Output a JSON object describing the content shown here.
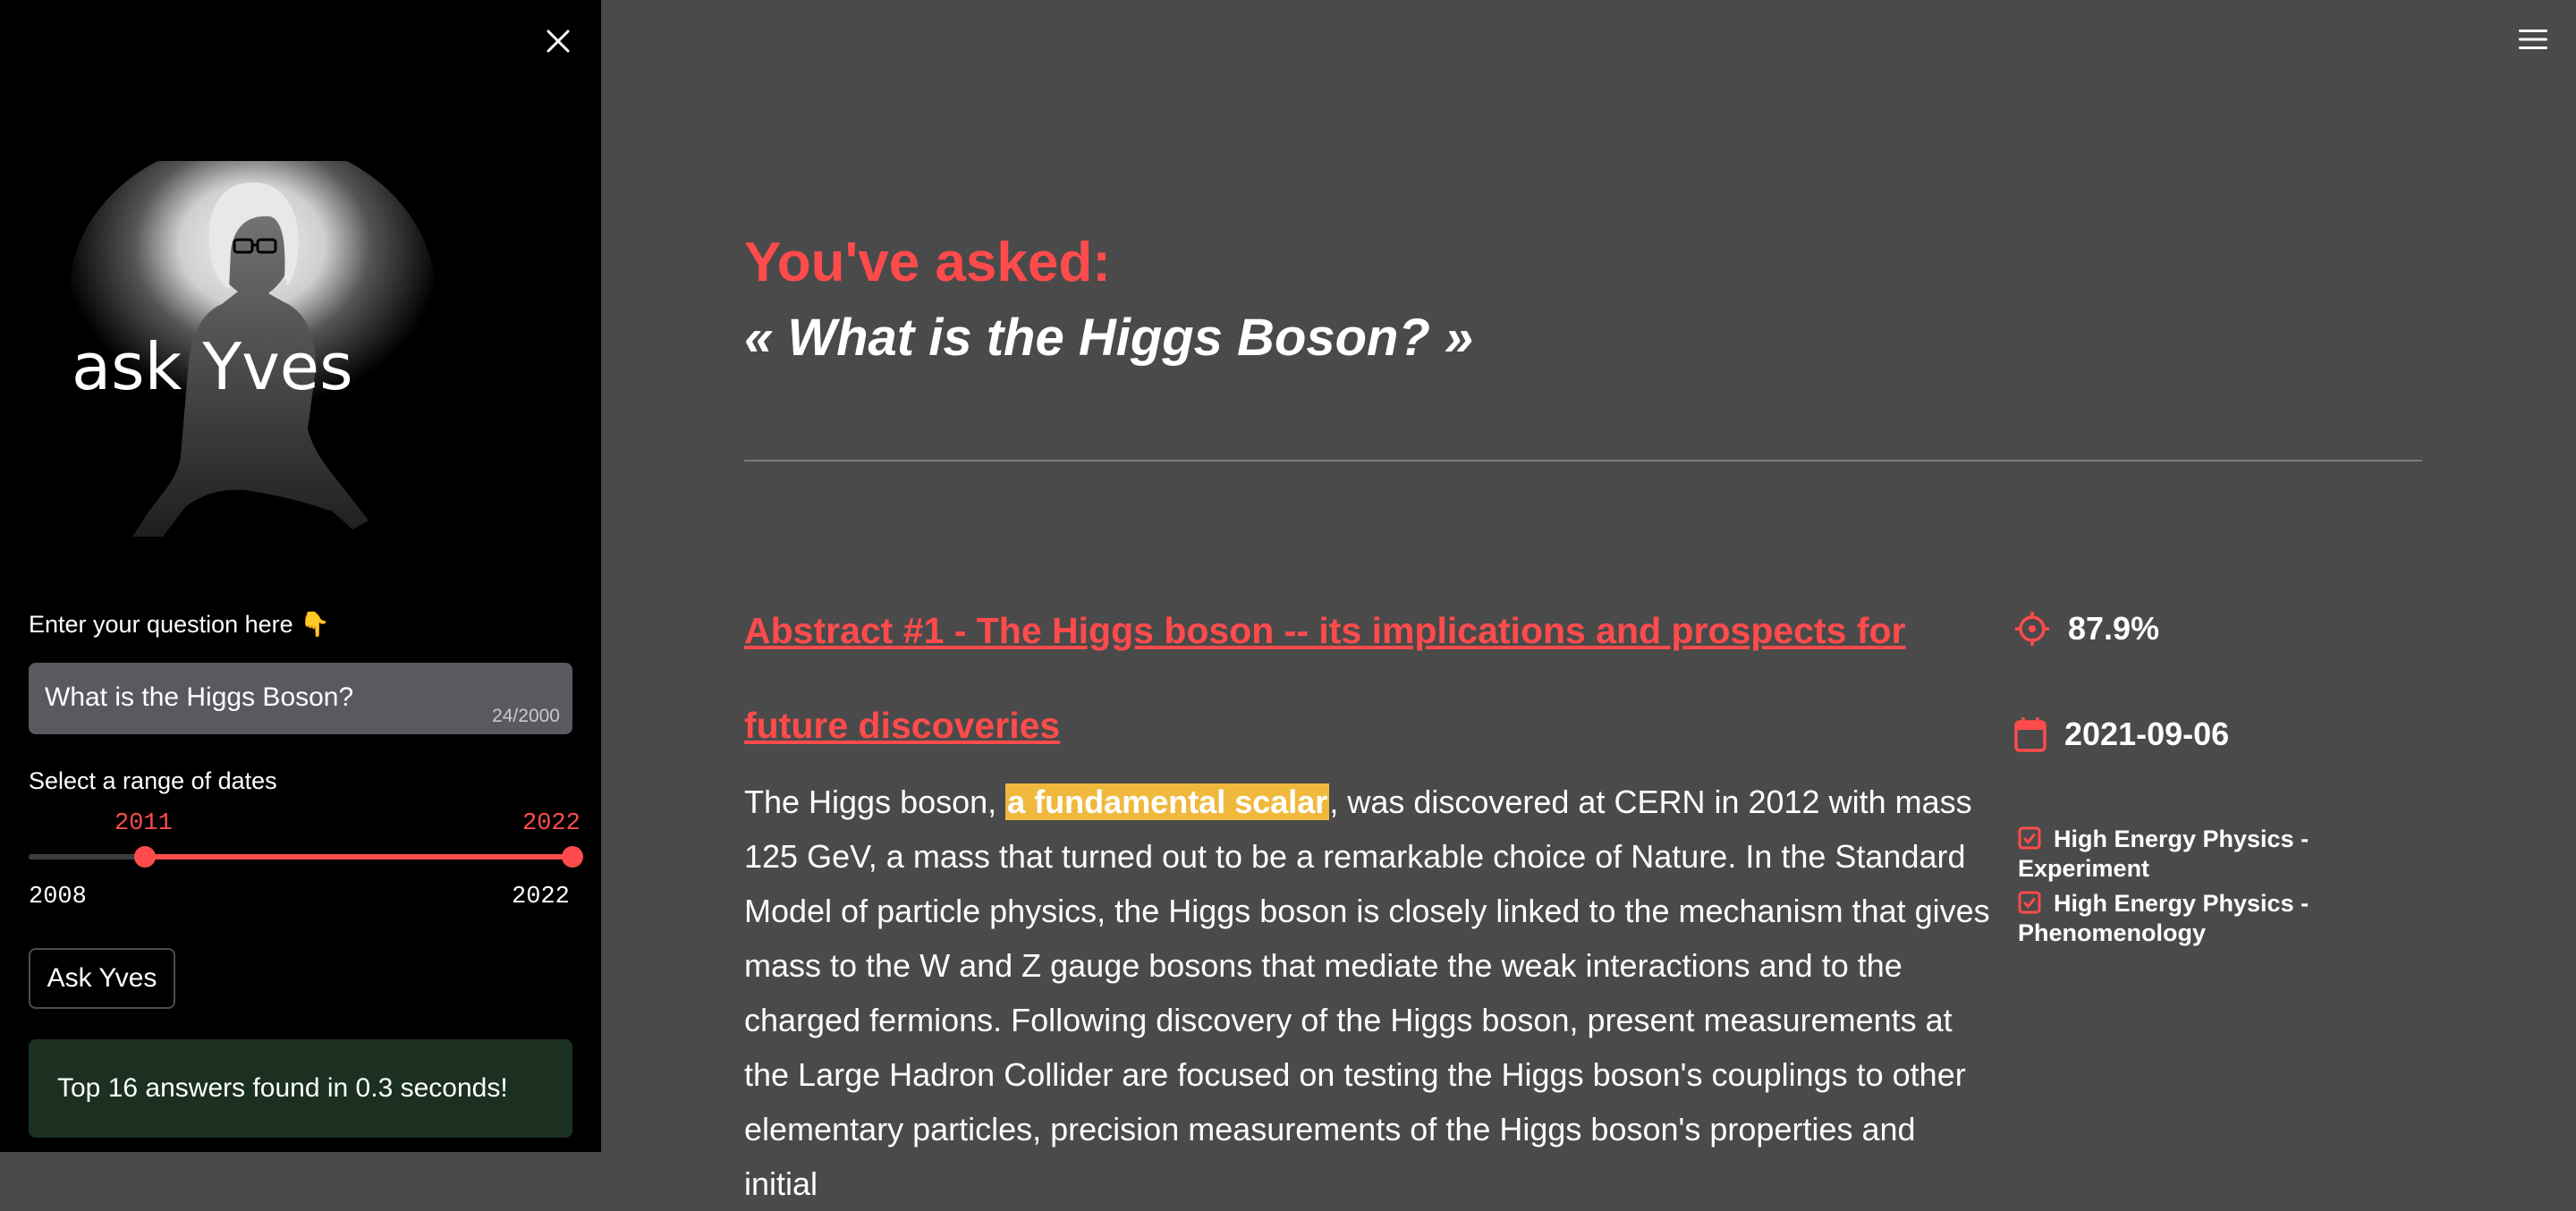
{
  "sidebar": {
    "logo_text": "ask Yves",
    "question_label": "Enter your question here 👇",
    "question_value": "What is the Higgs Boson?",
    "question_counter": "24/2000",
    "date_label": "Select a range of dates",
    "slider": {
      "low_value": "2011",
      "high_value": "2022",
      "min_label": "2008",
      "max_label": "2022"
    },
    "ask_button": "Ask Yves",
    "status_message": "Top 16 answers found in 0.3 seconds!"
  },
  "main": {
    "asked_heading": "You've asked:",
    "asked_question": "« What is the Higgs Boson? »",
    "result": {
      "title": "Abstract #1 - The Higgs boson -- its implications and prospects for future discoveries",
      "body_before": "The Higgs boson, ",
      "body_highlight": "a fundamental scalar",
      "body_after": ", was discovered at CERN in 2012 with mass 125 GeV, a mass that turned out to be a remarkable choice of Nature. In the Standard Model of particle physics, the Higgs boson is closely linked to the mechanism that gives mass to the W and Z gauge bosons that mediate the weak interactions and to the charged fermions. Following discovery of the Higgs boson, present measurements at the Large Hadron Collider are focused on testing the Higgs boson's couplings to other elementary particles, precision measurements of the Higgs boson's properties and initial",
      "score": "87.9%",
      "date": "2021-09-06",
      "categories": [
        "High Energy Physics - Experiment",
        "High Energy Physics - Phenomenology"
      ]
    }
  },
  "colors": {
    "accent": "#ff4b4b",
    "highlight": "#f0b93e",
    "main_background": "#4a4a4a",
    "sidebar_background": "#000000",
    "status_background": "#1b3020"
  },
  "icons": {
    "close": "close-icon",
    "menu": "hamburger-menu-icon",
    "score": "crosshair-icon",
    "date": "calendar-icon",
    "category": "checkbox-checked-icon"
  }
}
